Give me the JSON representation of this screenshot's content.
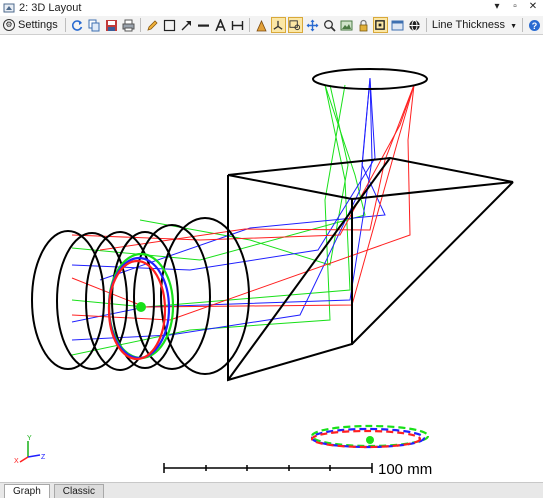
{
  "window": {
    "title": "2: 3D Layout",
    "controls": [
      "pin-icon",
      "maximize-icon",
      "close-icon"
    ]
  },
  "toolbar": {
    "settings_label": "Settings",
    "line_thickness_label": "Line Thickness",
    "icons": [
      "refresh-icon",
      "copy-icon",
      "save-icon",
      "print-icon",
      "pencil-icon",
      "rectangle-icon",
      "arrow-icon",
      "line-icon",
      "text-icon",
      "dimension-icon",
      "annotation-icon",
      "rotate-axes-icon",
      "zoom-window-icon",
      "pan-icon",
      "zoom-icon",
      "export-image-icon",
      "lock-icon",
      "fit-icon",
      "window-icon",
      "globe-icon",
      "help-icon"
    ]
  },
  "scale_bar": {
    "label": "100 mm"
  },
  "axis_labels": {
    "x": "X",
    "y": "Y",
    "z": "Z"
  },
  "colors": {
    "ray_red": "#ff2020",
    "ray_green": "#19e019",
    "ray_blue": "#2020ff",
    "lens": "#000000"
  },
  "tabs": [
    {
      "label": "Graph",
      "active": true
    },
    {
      "label": "Classic",
      "active": false
    }
  ]
}
